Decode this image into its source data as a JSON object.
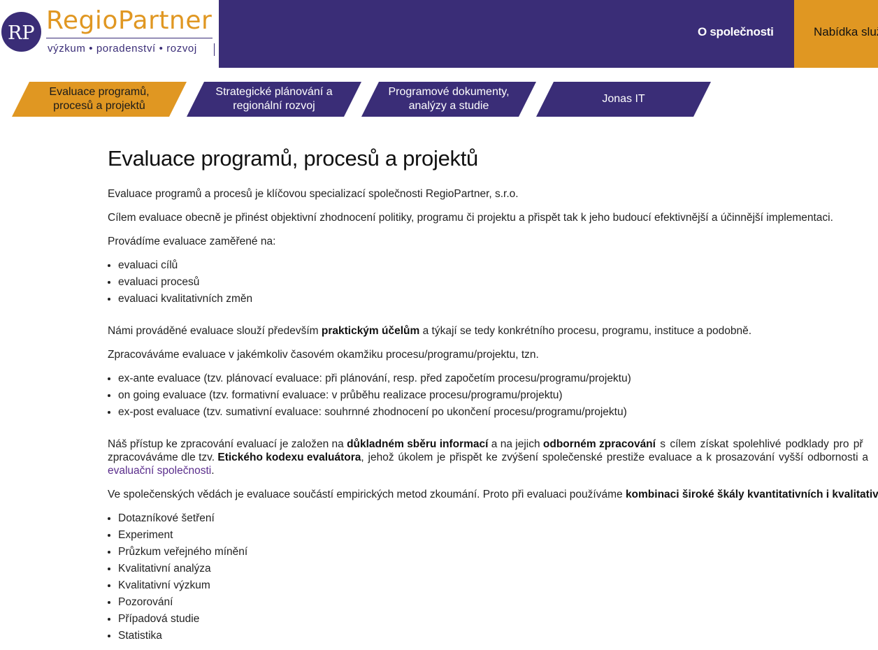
{
  "logo": {
    "monogram": "RP",
    "name_part1": "Regio",
    "name_part2": "Partner",
    "tagline": "výzkum • poradenství • rozvoj"
  },
  "topnav": {
    "company": "O společnosti",
    "services": "Nabídka služeb"
  },
  "tabs": [
    {
      "line1": "Evaluace programů,",
      "line2": "procesů a projektů"
    },
    {
      "line1": "Strategické plánování a",
      "line2": "regionální rozvoj"
    },
    {
      "line1": "Programové dokumenty,",
      "line2": "analýzy a studie"
    },
    {
      "line1": "Jonas IT",
      "line2": ""
    }
  ],
  "colors": {
    "primary": "#3a2d77",
    "accent": "#e09722"
  },
  "content": {
    "title": "Evaluace programů, procesů a projektů",
    "p1": "Evaluace programů a procesů je klíčovou specializací společnosti RegioPartner, s.r.o.",
    "p2": "Cílem evaluace obecně je přinést objektivní zhodnocení politiky, programu či projektu a přispět tak k jeho budoucí efektivnější a účinnější implementaci.",
    "p3": "Provádíme evaluace zaměřené na:",
    "list1": [
      "evaluaci cílů",
      "evaluaci procesů",
      "evaluaci kvalitativních změn"
    ],
    "p4_a": "Námi prováděné evaluace slouží především ",
    "p4_b": "praktickým účelům",
    "p4_c": " a týkají se tedy konkrétního procesu, programu, instituce a podobně.",
    "p5": "Zpracováváme evaluace v jakémkoliv časovém okamžiku procesu/programu/projektu, tzn.",
    "list2": [
      "ex-ante evaluace (tzv. plánovací evaluace: při plánování, resp. před započetím procesu/programu/projektu)",
      "on going evaluace (tzv. formativní evaluace: v průběhu realizace procesu/programu/projektu)",
      "ex-post evaluace (tzv. sumativní evaluace: souhrnné zhodnocení po ukončení procesu/programu/projektu)"
    ],
    "p6_a": "Náš přístup ke zpracování evaluací je založen na ",
    "p6_b": "důkladném sběru informací",
    "p6_c": " a na jejich ",
    "p6_d": "odborném zpracování",
    "p6_e": " s cílem získat spolehlivé podklady pro př",
    "p6_f": "zpracováváme dle tzv. ",
    "p6_g": "Etického kodexu evaluátora",
    "p6_h": ", jehož úkolem je přispět ke zvýšení společenské prestiže evaluace a k prosazování vyšší odbornosti a",
    "p6_link": "evaluační společnosti",
    "p6_end": ".",
    "p7_a": "Ve společenských vědách je evaluace součástí empirických metod zkoumání. Proto při evaluaci používáme ",
    "p7_b": "kombinaci široké škály kvantitativních i kvalitativníc",
    "list3": [
      "Dotazníkové šetření",
      "Experiment",
      "Průzkum veřejného mínění",
      "Kvalitativní analýza",
      "Kvalitativní výzkum",
      "Pozorování",
      "Případová studie",
      "Statistika"
    ]
  }
}
